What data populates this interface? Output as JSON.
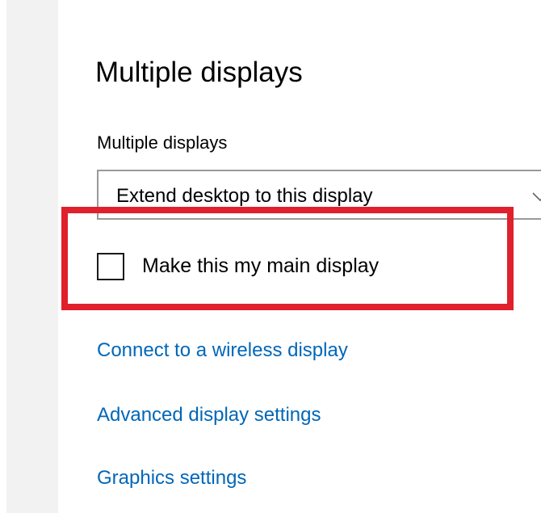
{
  "section": {
    "title": "Multiple displays"
  },
  "dropdown": {
    "label": "Multiple displays",
    "value": "Extend desktop to this display",
    "icon": "chevron-down-icon"
  },
  "checkbox": {
    "label": "Make this my main display",
    "checked": false
  },
  "highlight": {
    "color": "#e0202c"
  },
  "links": [
    {
      "label": "Connect to a wireless display"
    },
    {
      "label": "Advanced display settings"
    },
    {
      "label": "Graphics settings"
    }
  ],
  "colors": {
    "link": "#0067b8",
    "sidebar": "#f2f2f2"
  }
}
